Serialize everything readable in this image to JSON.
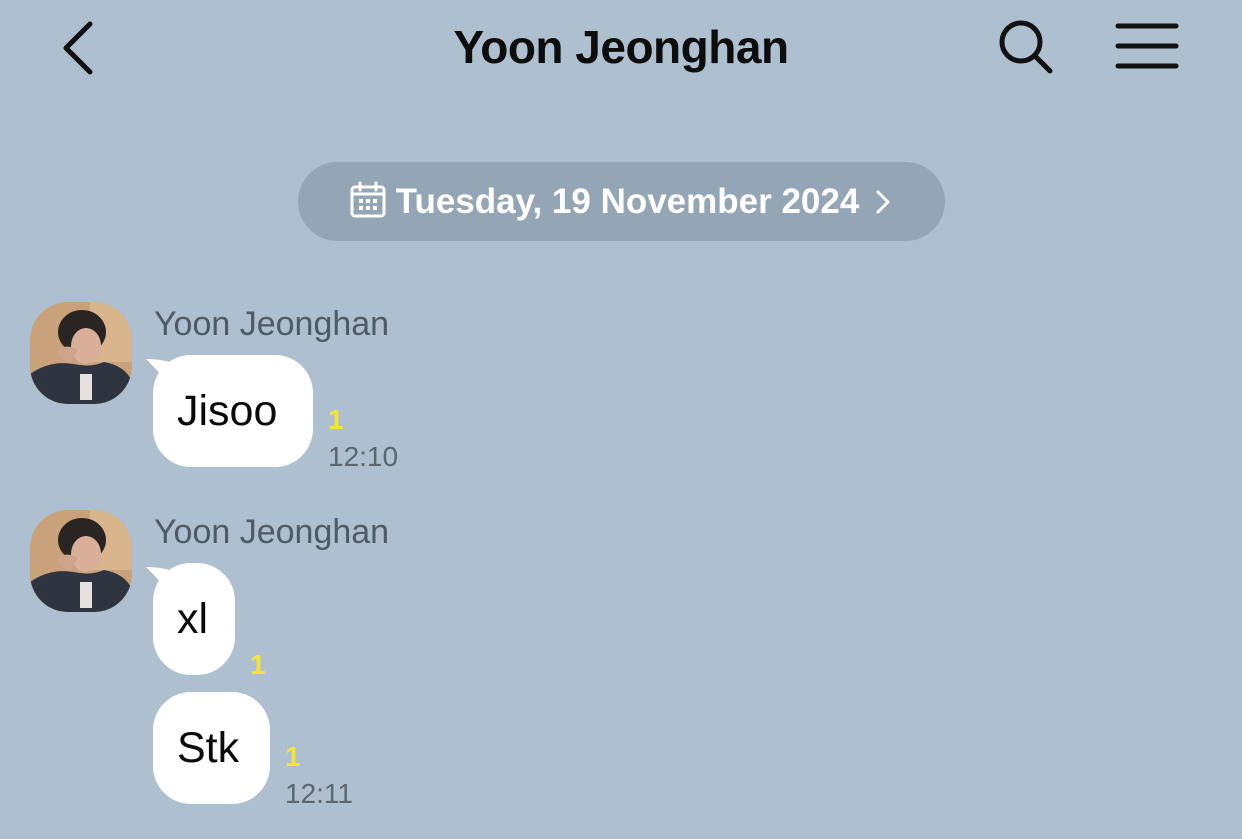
{
  "header": {
    "title": "Yoon Jeonghan",
    "back_icon": "chevron-left-icon",
    "search_icon": "search-icon",
    "menu_icon": "hamburger-menu-icon"
  },
  "date_divider": {
    "text": "Tuesday, 19 November 2024",
    "icon": "calendar-icon",
    "trailing_icon": "chevron-right-icon"
  },
  "messages": [
    {
      "sender": "Yoon Jeonghan",
      "bubbles": [
        {
          "text": "Jisoo",
          "unread": "1",
          "time": "12:10"
        }
      ]
    },
    {
      "sender": "Yoon Jeonghan",
      "bubbles": [
        {
          "text": "xl",
          "unread": "1",
          "time": ""
        },
        {
          "text": "Stk",
          "unread": "1",
          "time": "12:11"
        }
      ]
    }
  ],
  "colors": {
    "background": "#aec0cf",
    "date_pill": "#94a6b6",
    "bubble": "#ffffff",
    "unread_count": "#f4e43c",
    "sender_name": "#4f5a64",
    "timestamp": "#5a6570"
  }
}
